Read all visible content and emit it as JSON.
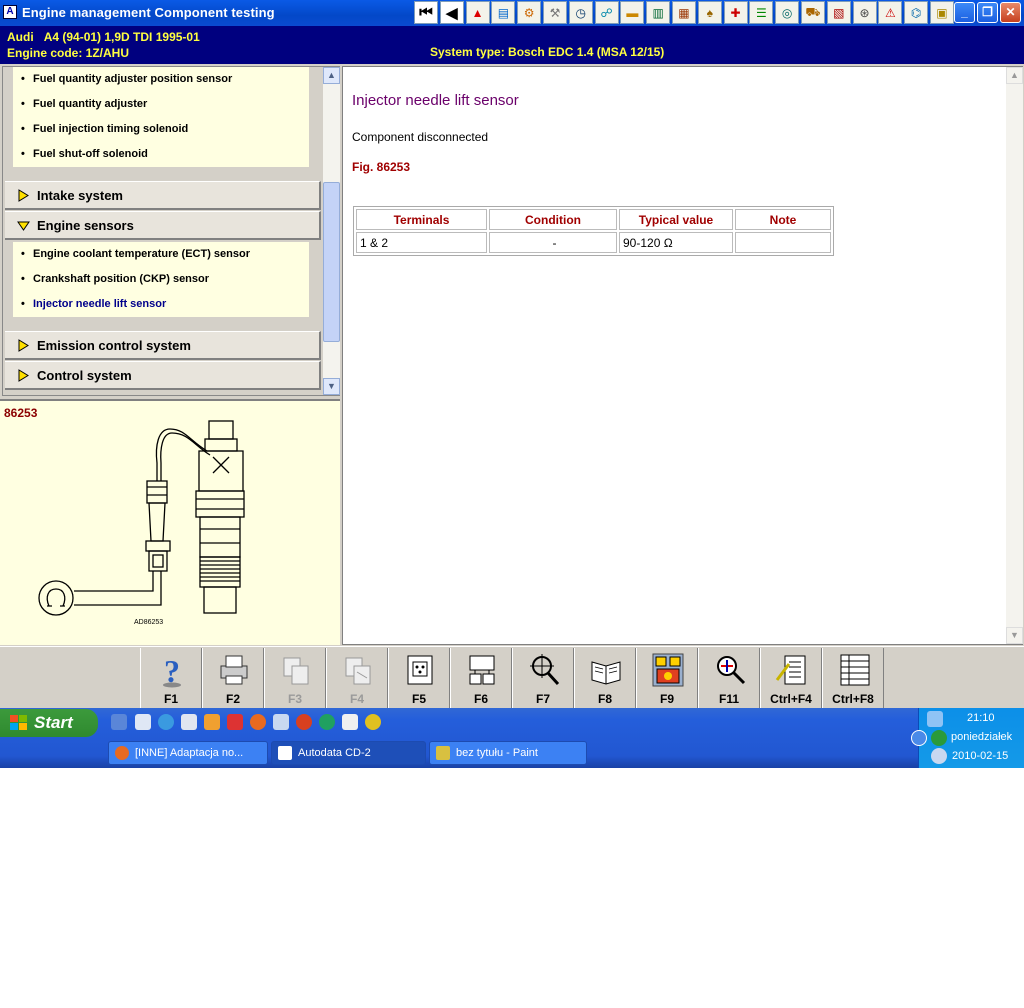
{
  "window": {
    "title": "Engine management Component testing",
    "toolbar_icons": [
      "first-page-icon",
      "prev-page-icon",
      "warning-icon",
      "chart-icon",
      "gear-icon",
      "wrench-icon",
      "clock-icon",
      "diagnostic-icon",
      "battery-icon",
      "timing-belt-icon",
      "engine-icon",
      "oil-can-icon",
      "service-icon",
      "wiring-icon",
      "sensor-icon",
      "vehicle-icon",
      "data-icon",
      "steering-icon",
      "injector-icon",
      "abs-icon",
      "radio-icon",
      "note-icon"
    ]
  },
  "vehicle": {
    "make": "Audi",
    "model": "A4 (94-01) 1,9D TDI 1995-01",
    "engine_code": "Engine code: 1Z/AHU",
    "system_type": "System type: Bosch EDC 1.4 (MSA 12/15)"
  },
  "nav": {
    "group1_items": [
      "Fuel quantity adjuster position sensor",
      "Fuel quantity adjuster",
      "Fuel injection timing solenoid",
      "Fuel shut-off solenoid"
    ],
    "intake": "Intake system",
    "engine_sensors": "Engine sensors",
    "sensor_items": [
      "Engine coolant temperature (ECT) sensor",
      "Crankshaft position (CKP) sensor",
      "Injector needle lift sensor"
    ],
    "emission": "Emission control system",
    "control": "Control system"
  },
  "figure": {
    "number": "86253",
    "caption": "AD86253"
  },
  "content": {
    "title": "Injector needle lift sensor",
    "status": "Component disconnected",
    "fig_ref": "Fig. 86253",
    "columns": [
      "Terminals",
      "Condition",
      "Typical value",
      "Note"
    ],
    "row": [
      "1 & 2",
      "-",
      "90-120 Ω",
      ""
    ]
  },
  "fkeys": [
    {
      "label": "F1",
      "icon": "help-icon",
      "enabled": true
    },
    {
      "label": "F2",
      "icon": "print-icon",
      "enabled": true
    },
    {
      "label": "F3",
      "icon": "copy-icon",
      "enabled": false
    },
    {
      "label": "F4",
      "icon": "paste-icon",
      "enabled": false
    },
    {
      "label": "F5",
      "icon": "connector-icon",
      "enabled": true
    },
    {
      "label": "F6",
      "icon": "pinout-icon",
      "enabled": true
    },
    {
      "label": "F7",
      "icon": "locate-icon",
      "enabled": true
    },
    {
      "label": "F8",
      "icon": "book-icon",
      "enabled": true
    },
    {
      "label": "F9",
      "icon": "component-test-icon",
      "enabled": true
    },
    {
      "label": "F11",
      "icon": "fault-search-icon",
      "enabled": true
    },
    {
      "label": "Ctrl+F4",
      "icon": "notes-icon",
      "enabled": true
    },
    {
      "label": "Ctrl+F8",
      "icon": "list-icon",
      "enabled": true
    }
  ],
  "taskbar": {
    "start": "Start",
    "tasks": [
      "[INNE] Adaptacja no...",
      "Autodata CD-2",
      "bez tytułu - Paint"
    ],
    "time": "21:10",
    "day": "poniedziałek",
    "date": "2010-02-15"
  },
  "colors": {
    "title_bar": "#0a5ae6",
    "info_bar": "#00007f",
    "info_text": "#ffff40",
    "content_title": "#6a006a",
    "table_header": "#a00000"
  }
}
